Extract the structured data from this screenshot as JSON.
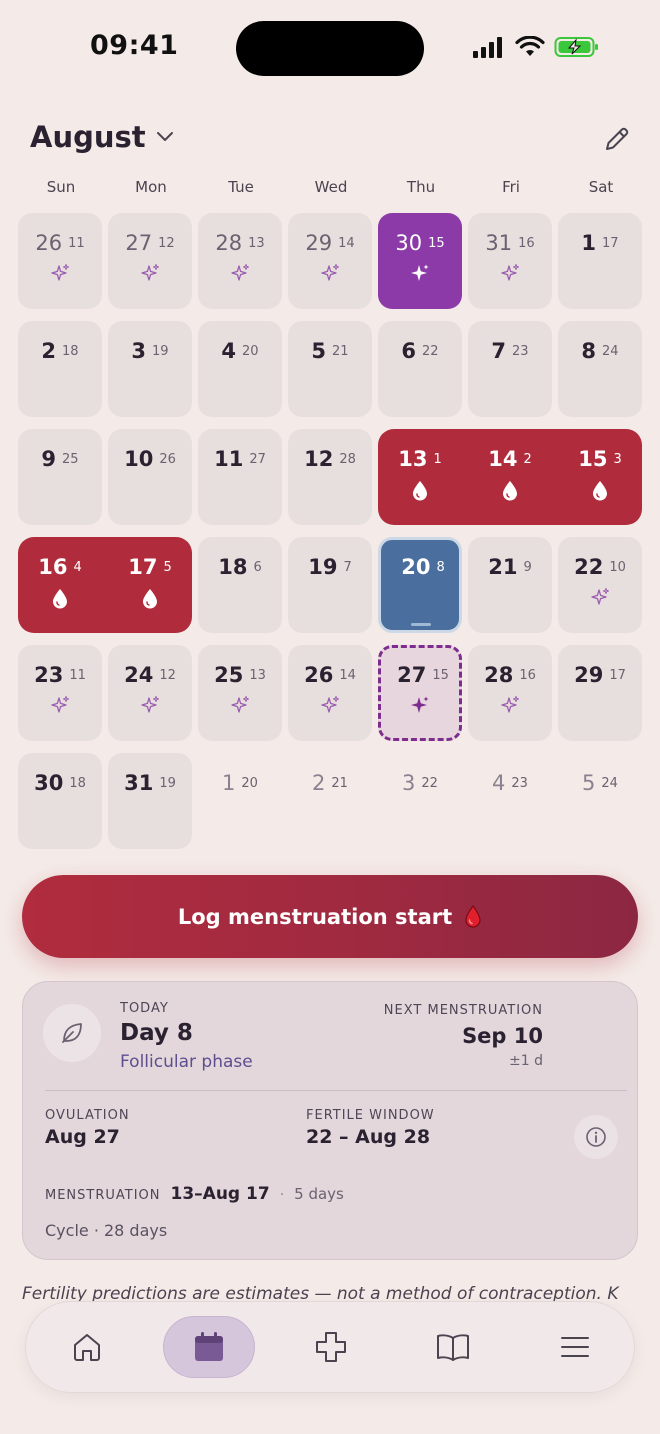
{
  "status_bar": {
    "time": "09:41"
  },
  "header": {
    "month": "August"
  },
  "weekdays": [
    "Sun",
    "Mon",
    "Tue",
    "Wed",
    "Thu",
    "Fri",
    "Sat"
  ],
  "calendar": {
    "rows": [
      [
        {
          "day": "26",
          "cycle": "11",
          "type": "pred",
          "icon": "sparkle-icon"
        },
        {
          "day": "27",
          "cycle": "12",
          "type": "pred",
          "icon": "sparkle-icon"
        },
        {
          "day": "28",
          "cycle": "13",
          "type": "pred",
          "icon": "sparkle-icon"
        },
        {
          "day": "29",
          "cycle": "14",
          "type": "pred",
          "icon": "sparkle-icon"
        },
        {
          "day": "30",
          "cycle": "15",
          "type": "purple",
          "icon": "sparkle-icon"
        },
        {
          "day": "31",
          "cycle": "16",
          "type": "pred",
          "icon": "sparkle-icon"
        },
        {
          "day": "1",
          "cycle": "17",
          "type": "normal",
          "icon": ""
        }
      ],
      [
        {
          "day": "2",
          "cycle": "18",
          "type": "normal",
          "icon": ""
        },
        {
          "day": "3",
          "cycle": "19",
          "type": "normal",
          "icon": ""
        },
        {
          "day": "4",
          "cycle": "20",
          "type": "normal",
          "icon": ""
        },
        {
          "day": "5",
          "cycle": "21",
          "type": "normal",
          "icon": ""
        },
        {
          "day": "6",
          "cycle": "22",
          "type": "normal",
          "icon": ""
        },
        {
          "day": "7",
          "cycle": "23",
          "type": "normal",
          "icon": ""
        },
        {
          "day": "8",
          "cycle": "24",
          "type": "normal",
          "icon": ""
        }
      ],
      [
        {
          "day": "9",
          "cycle": "25",
          "type": "normal",
          "icon": ""
        },
        {
          "day": "10",
          "cycle": "26",
          "type": "normal",
          "icon": ""
        },
        {
          "day": "11",
          "cycle": "27",
          "type": "normal",
          "icon": ""
        },
        {
          "day": "12",
          "cycle": "28",
          "type": "normal",
          "icon": ""
        },
        {
          "day": "13",
          "cycle": "1",
          "type": "period",
          "icon": "drop-icon"
        },
        {
          "day": "14",
          "cycle": "2",
          "type": "period",
          "icon": "drop-icon"
        },
        {
          "day": "15",
          "cycle": "3",
          "type": "period",
          "icon": "drop-icon"
        }
      ],
      [
        {
          "day": "16",
          "cycle": "4",
          "type": "period",
          "icon": "drop-icon"
        },
        {
          "day": "17",
          "cycle": "5",
          "type": "period",
          "icon": "drop-icon"
        },
        {
          "day": "18",
          "cycle": "6",
          "type": "normal",
          "icon": ""
        },
        {
          "day": "19",
          "cycle": "7",
          "type": "normal",
          "icon": ""
        },
        {
          "day": "20",
          "cycle": "8",
          "type": "today",
          "icon": ""
        },
        {
          "day": "21",
          "cycle": "9",
          "type": "normal",
          "icon": ""
        },
        {
          "day": "22",
          "cycle": "10",
          "type": "normal",
          "icon": "sparkle-icon"
        }
      ],
      [
        {
          "day": "23",
          "cycle": "11",
          "type": "normal",
          "icon": "sparkle-icon"
        },
        {
          "day": "24",
          "cycle": "12",
          "type": "normal",
          "icon": "sparkle-icon"
        },
        {
          "day": "25",
          "cycle": "13",
          "type": "normal",
          "icon": "sparkle-icon"
        },
        {
          "day": "26",
          "cycle": "14",
          "type": "normal",
          "icon": "sparkle-icon"
        },
        {
          "day": "27",
          "cycle": "15",
          "type": "ovulation",
          "icon": "sparkle-icon"
        },
        {
          "day": "28",
          "cycle": "16",
          "type": "normal",
          "icon": "sparkle-icon"
        },
        {
          "day": "29",
          "cycle": "17",
          "type": "normal",
          "icon": ""
        }
      ],
      [
        {
          "day": "30",
          "cycle": "18",
          "type": "normal",
          "icon": ""
        },
        {
          "day": "31",
          "cycle": "19",
          "type": "normal",
          "icon": ""
        },
        {
          "day": "1",
          "cycle": "20",
          "type": "out",
          "icon": ""
        },
        {
          "day": "2",
          "cycle": "21",
          "type": "out",
          "icon": ""
        },
        {
          "day": "3",
          "cycle": "22",
          "type": "out",
          "icon": ""
        },
        {
          "day": "4",
          "cycle": "23",
          "type": "out",
          "icon": ""
        },
        {
          "day": "5",
          "cycle": "24",
          "type": "out",
          "icon": ""
        }
      ]
    ]
  },
  "log_button": {
    "label": "Log menstruation start"
  },
  "card": {
    "today_label": "TODAY",
    "day_value": "Day 8",
    "phase": "Follicular phase",
    "next_label": "NEXT MENSTRUATION",
    "next_value": "Sep 10",
    "next_sub": "±1 d",
    "ovulation_label": "OVULATION",
    "ovulation_value": "Aug 27",
    "fertile_label": "FERTILE WINDOW",
    "fertile_value": "22 – Aug 28",
    "menstruation_label": "MENSTRUATION",
    "menstruation_value": "13–Aug 17",
    "menstruation_sep": "·",
    "menstruation_days": "5 days",
    "cycle": "Cycle · 28 days"
  },
  "disclaimer": "Fertility predictions are estimates — not a method of contraception. K",
  "tabs": [
    {
      "name": "tab-home",
      "icon": "home-icon"
    },
    {
      "name": "tab-calendar",
      "icon": "calendar-icon",
      "active": true
    },
    {
      "name": "tab-health",
      "icon": "plus-icon"
    },
    {
      "name": "tab-learn",
      "icon": "book-icon"
    },
    {
      "name": "tab-menu",
      "icon": "menu-icon"
    }
  ],
  "colors": {
    "background": "#f4ebe8",
    "period": "#b02c3c",
    "ovulation_purple": "#8b3aa8",
    "today": "#4a6f9e",
    "accent": "#5c4f8e"
  }
}
